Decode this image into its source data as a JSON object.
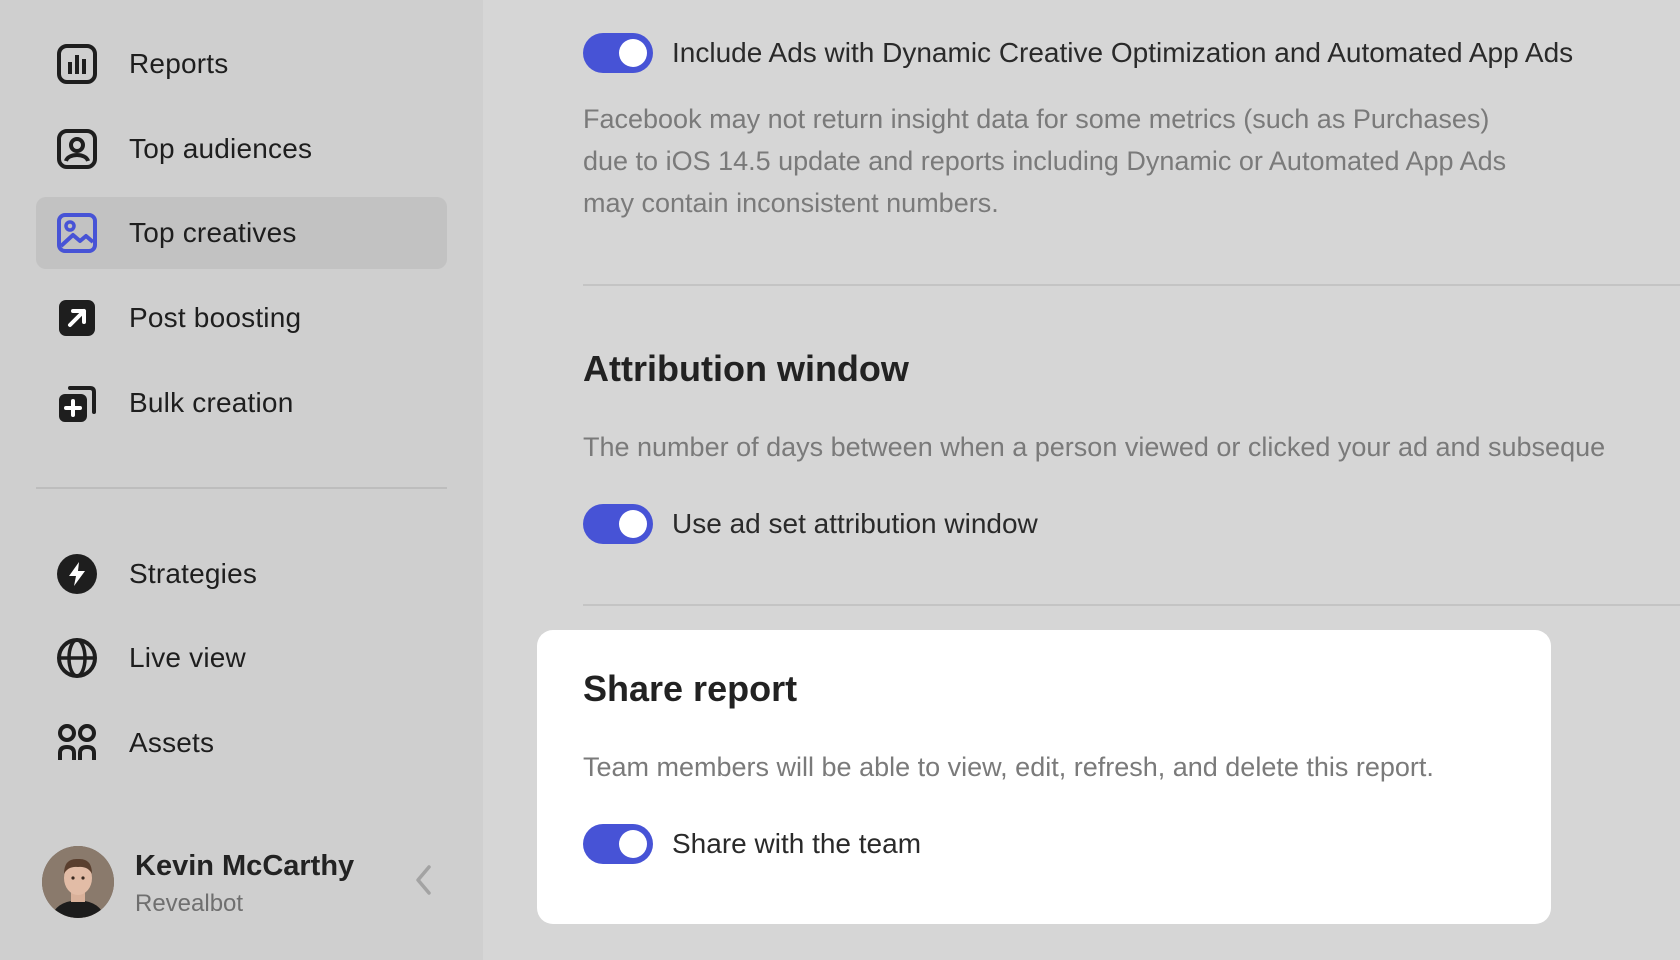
{
  "sidebar": {
    "items": [
      {
        "label": "Reports",
        "icon": "bar-chart-icon"
      },
      {
        "label": "Top audiences",
        "icon": "user-badge-icon"
      },
      {
        "label": "Top creatives",
        "icon": "image-icon",
        "active": true
      },
      {
        "label": "Post boosting",
        "icon": "arrow-up-right-icon"
      },
      {
        "label": "Bulk creation",
        "icon": "copy-plus-icon"
      },
      {
        "label": "Strategies",
        "icon": "lightning-icon"
      },
      {
        "label": "Live view",
        "icon": "globe-icon"
      },
      {
        "label": "Assets",
        "icon": "grid-circles-icon"
      }
    ],
    "user": {
      "name": "Kevin McCarthy",
      "org": "Revealbot"
    }
  },
  "main": {
    "dynamic_ads": {
      "toggle_label": "Include Ads with Dynamic Creative Optimization and Automated App Ads",
      "enabled": true,
      "note_lines": [
        "Facebook may not return insight data for some metrics (such as Purchases)",
        "due to iOS 14.5 update and reports including Dynamic or Automated App Ads",
        "may contain inconsistent numbers."
      ]
    },
    "attribution": {
      "title": "Attribution window",
      "description": "The number of days between when a person viewed or clicked your ad and subseque",
      "toggle_label": "Use ad set attribution window",
      "enabled": true
    },
    "share": {
      "title": "Share report",
      "description": "Team members will be able to view, edit, refresh, and delete this report.",
      "toggle_label": "Share with the team",
      "enabled": true
    }
  },
  "colors": {
    "accent": "#4753d6",
    "active_icon": "#4753d6"
  }
}
